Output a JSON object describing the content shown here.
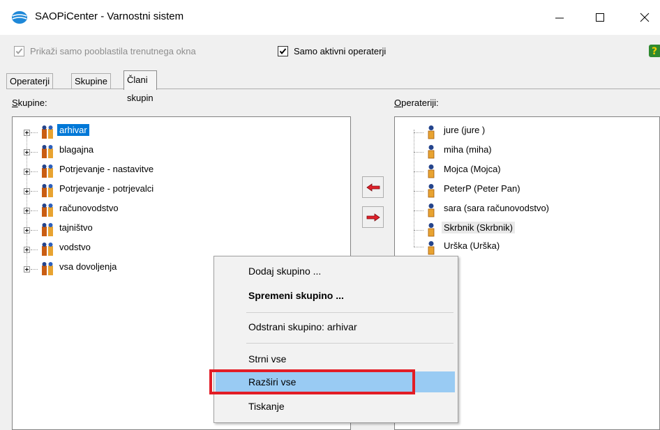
{
  "window": {
    "title": "SAOPiCenter - Varnostni sistem"
  },
  "options": {
    "only_current_window_permissions": {
      "label": "Prikaži samo pooblastila trenutnega okna",
      "checked": true,
      "enabled": false
    },
    "only_active_operators": {
      "label": "Samo aktivni operaterji",
      "checked": true,
      "enabled": true
    }
  },
  "tabs": [
    {
      "label": "Operaterji",
      "active": false
    },
    {
      "label": "Skupine",
      "active": false
    },
    {
      "label": "Člani skupin",
      "active": true
    }
  ],
  "groups_panel": {
    "label_accel": "S",
    "label_rest": "kupine:",
    "items": [
      {
        "label": "arhivar",
        "selected": true
      },
      {
        "label": "blagajna"
      },
      {
        "label": "Potrjevanje - nastavitve"
      },
      {
        "label": "Potrjevanje - potrjevalci"
      },
      {
        "label": "računovodstvo"
      },
      {
        "label": "tajništvo"
      },
      {
        "label": "vodstvo"
      },
      {
        "label": "vsa dovoljenja"
      }
    ]
  },
  "operators_panel": {
    "label_accel": "O",
    "label_rest": "perateriji:",
    "items": [
      {
        "label": "jure (jure )"
      },
      {
        "label": "miha (miha)"
      },
      {
        "label": "Mojca (Mojca)"
      },
      {
        "label": "PeterP (Peter Pan)"
      },
      {
        "label": "sara (sara računovodstvo)"
      },
      {
        "label": "Skrbnik (Skrbnik)",
        "hover": true
      },
      {
        "label": "Urška (Urška)"
      }
    ]
  },
  "context_menu": {
    "items": [
      {
        "label": "Dodaj skupino ..."
      },
      {
        "label": "Spremeni skupino ...",
        "bold": true
      },
      {
        "label": "Odstrani skupino: arhivar"
      },
      {
        "label": "Strni vse"
      },
      {
        "label": "Razširi vse",
        "highlighted": true
      },
      {
        "label": "Tiskanje"
      }
    ]
  },
  "colors": {
    "selection": "#0078d7",
    "menu_highlight": "#99cbf3",
    "annotation_frame": "#e21d26",
    "arrow_red": "#e0202a"
  }
}
